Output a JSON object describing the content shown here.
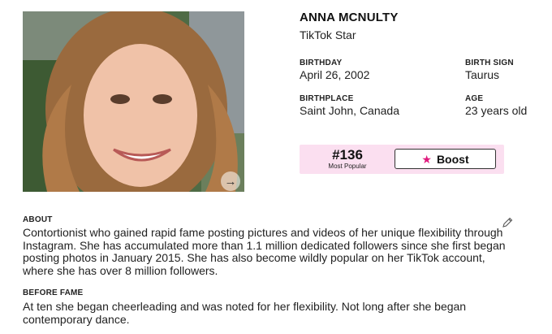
{
  "profile": {
    "name": "ANNA MCNULTY",
    "profession": "TikTok Star",
    "photo_icon": "arrow-right-icon"
  },
  "facts": {
    "birthday": {
      "label": "BIRTHDAY",
      "value": "April 26, 2002"
    },
    "birth_sign": {
      "label": "BIRTH SIGN",
      "value": "Taurus"
    },
    "birthplace": {
      "label": "BIRTHPLACE",
      "value": "Saint John, Canada"
    },
    "age": {
      "label": "AGE",
      "value": "23 years old"
    }
  },
  "rank": {
    "number": "#136",
    "label": "Most Popular",
    "boost_label": "Boost",
    "boost_icon": "star-icon",
    "accent_color": "#e0197d",
    "box_color": "#fbdff0"
  },
  "about": {
    "label": "ABOUT",
    "text": "Contortionist who gained rapid fame posting pictures and videos of her unique flexibility through Instagram. She has accumulated more than 1.1 million dedicated followers since she first began posting photos in January 2015. She has also become wildly popular on her TikTok account, where she has over 8 million followers.",
    "edit_icon": "pencil-icon"
  },
  "before_fame": {
    "label": "BEFORE FAME",
    "text": "At ten she began cheerleading and was noted for her flexibility. Not long after she began contemporary dance."
  }
}
